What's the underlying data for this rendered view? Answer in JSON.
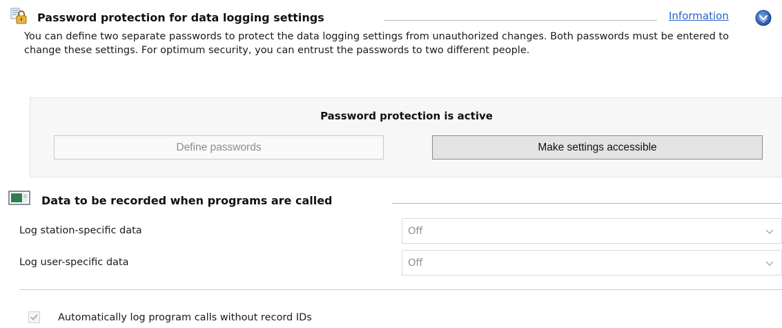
{
  "password_section": {
    "title": "Password protection for data logging settings",
    "info_link": "Information",
    "description": "You can define two separate passwords to protect the data logging settings from unauthorized changes. Both passwords must be entered to change these settings. For optimum security, you can entrust the passwords to two different people.",
    "status": "Password protection is active",
    "define_button": "Define passwords",
    "accessible_button": "Make settings accessible",
    "icons": {
      "section": "lock-icon",
      "info": "info-circle-icon"
    }
  },
  "recording_section": {
    "title": "Data to be recorded when programs are called",
    "icon": "monitor-icon",
    "fields": [
      {
        "label": "Log station-specific data",
        "value": "Off"
      },
      {
        "label": "Log user-specific data",
        "value": "Off"
      }
    ],
    "checkbox": {
      "label": "Automatically log program calls without record IDs",
      "checked": true,
      "disabled": true
    }
  },
  "colors": {
    "link": "#2a60c8",
    "disabled_text": "#8d8d8d",
    "group_background": "#f7f7f7",
    "button_background": "#e3e3e3",
    "separator": "#b9b9b9"
  }
}
